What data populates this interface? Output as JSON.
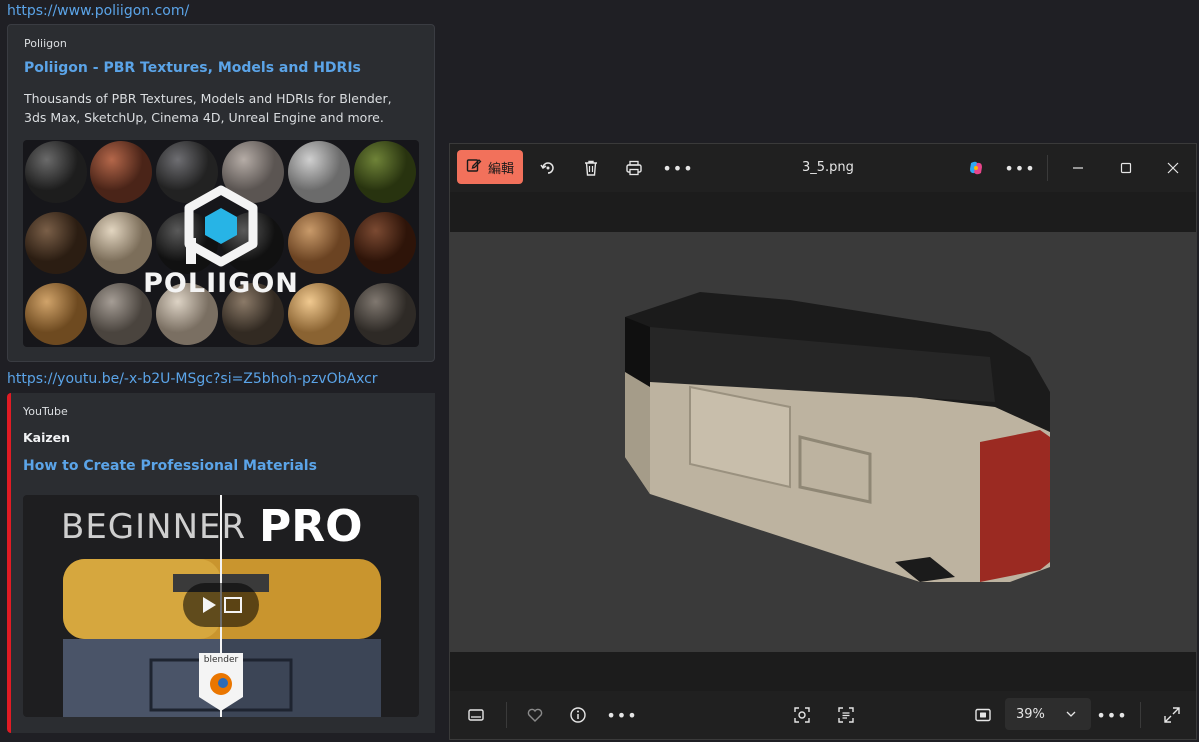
{
  "chat": {
    "link1": "https://www.poliigon.com/",
    "embed1": {
      "provider": "Poliigon",
      "title": "Poliigon - PBR Textures, Models and HDRIs",
      "description": "Thousands of PBR Textures, Models and HDRIs for Blender, 3ds Max, SketchUp, Cinema 4D, Unreal Engine and more.",
      "image_logo_text": "POLIIGON"
    },
    "link2": "https://youtu.be/-x-b2U-MSgc?si=Z5bhoh-pzvObAxcr",
    "embed2": {
      "provider": "YouTube",
      "author": "Kaizen",
      "title": "How to Create Professional Materials",
      "thumb_left": "BEGINNER",
      "thumb_right": "PRO",
      "thumb_badge": "blender"
    }
  },
  "viewer": {
    "edit_label": "編輯",
    "filename": "3_5.png",
    "zoom": "39%"
  },
  "colors": {
    "accent": "#f2715b",
    "link": "#5ba4e8",
    "youtube_bar": "#e01b24"
  },
  "icons": [
    "edit-icon",
    "rotate-icon",
    "delete-icon",
    "print-icon",
    "more-icon",
    "copilot-icon",
    "minimize-icon",
    "maximize-icon",
    "close-icon",
    "filmstrip-icon",
    "favorite-icon",
    "info-icon",
    "visual-search-icon",
    "text-scan-icon",
    "fit-icon",
    "chevron-down-icon",
    "fullscreen-icon"
  ]
}
